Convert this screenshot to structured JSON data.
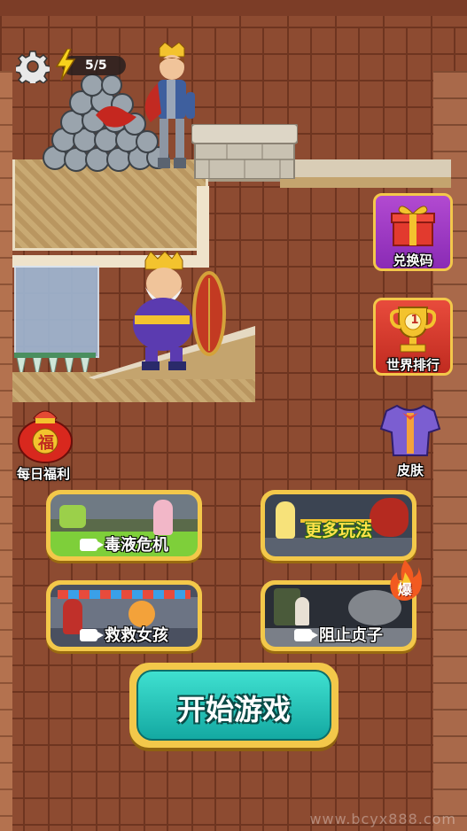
{
  "hud": {
    "energy": "5/5",
    "settings_icon": "gear-icon",
    "energy_icon": "lightning-bolt-icon"
  },
  "side_menu": {
    "redeem_code": "兑换码",
    "world_rank": "世界排行",
    "skin": "皮肤",
    "daily_bonus": "每日福利",
    "daily_bonus_char": "福"
  },
  "modes": [
    {
      "label": "毒液危机",
      "locked_by_video": true
    },
    {
      "label": "更多玩法",
      "locked_by_video": false
    },
    {
      "label": "救救女孩",
      "locked_by_video": true
    },
    {
      "label": "阻止贞子",
      "locked_by_video": true,
      "badge": "爆"
    }
  ],
  "start_button": "开始游戏",
  "trophy_rank": "1",
  "watermark": "www.bcyx888.com",
  "colors": {
    "wall": "#8d4b31",
    "card_border": "#f3c84a",
    "start_button": "#22c4bb",
    "gift": "#a23fcb",
    "trophy": "#d8392c"
  }
}
